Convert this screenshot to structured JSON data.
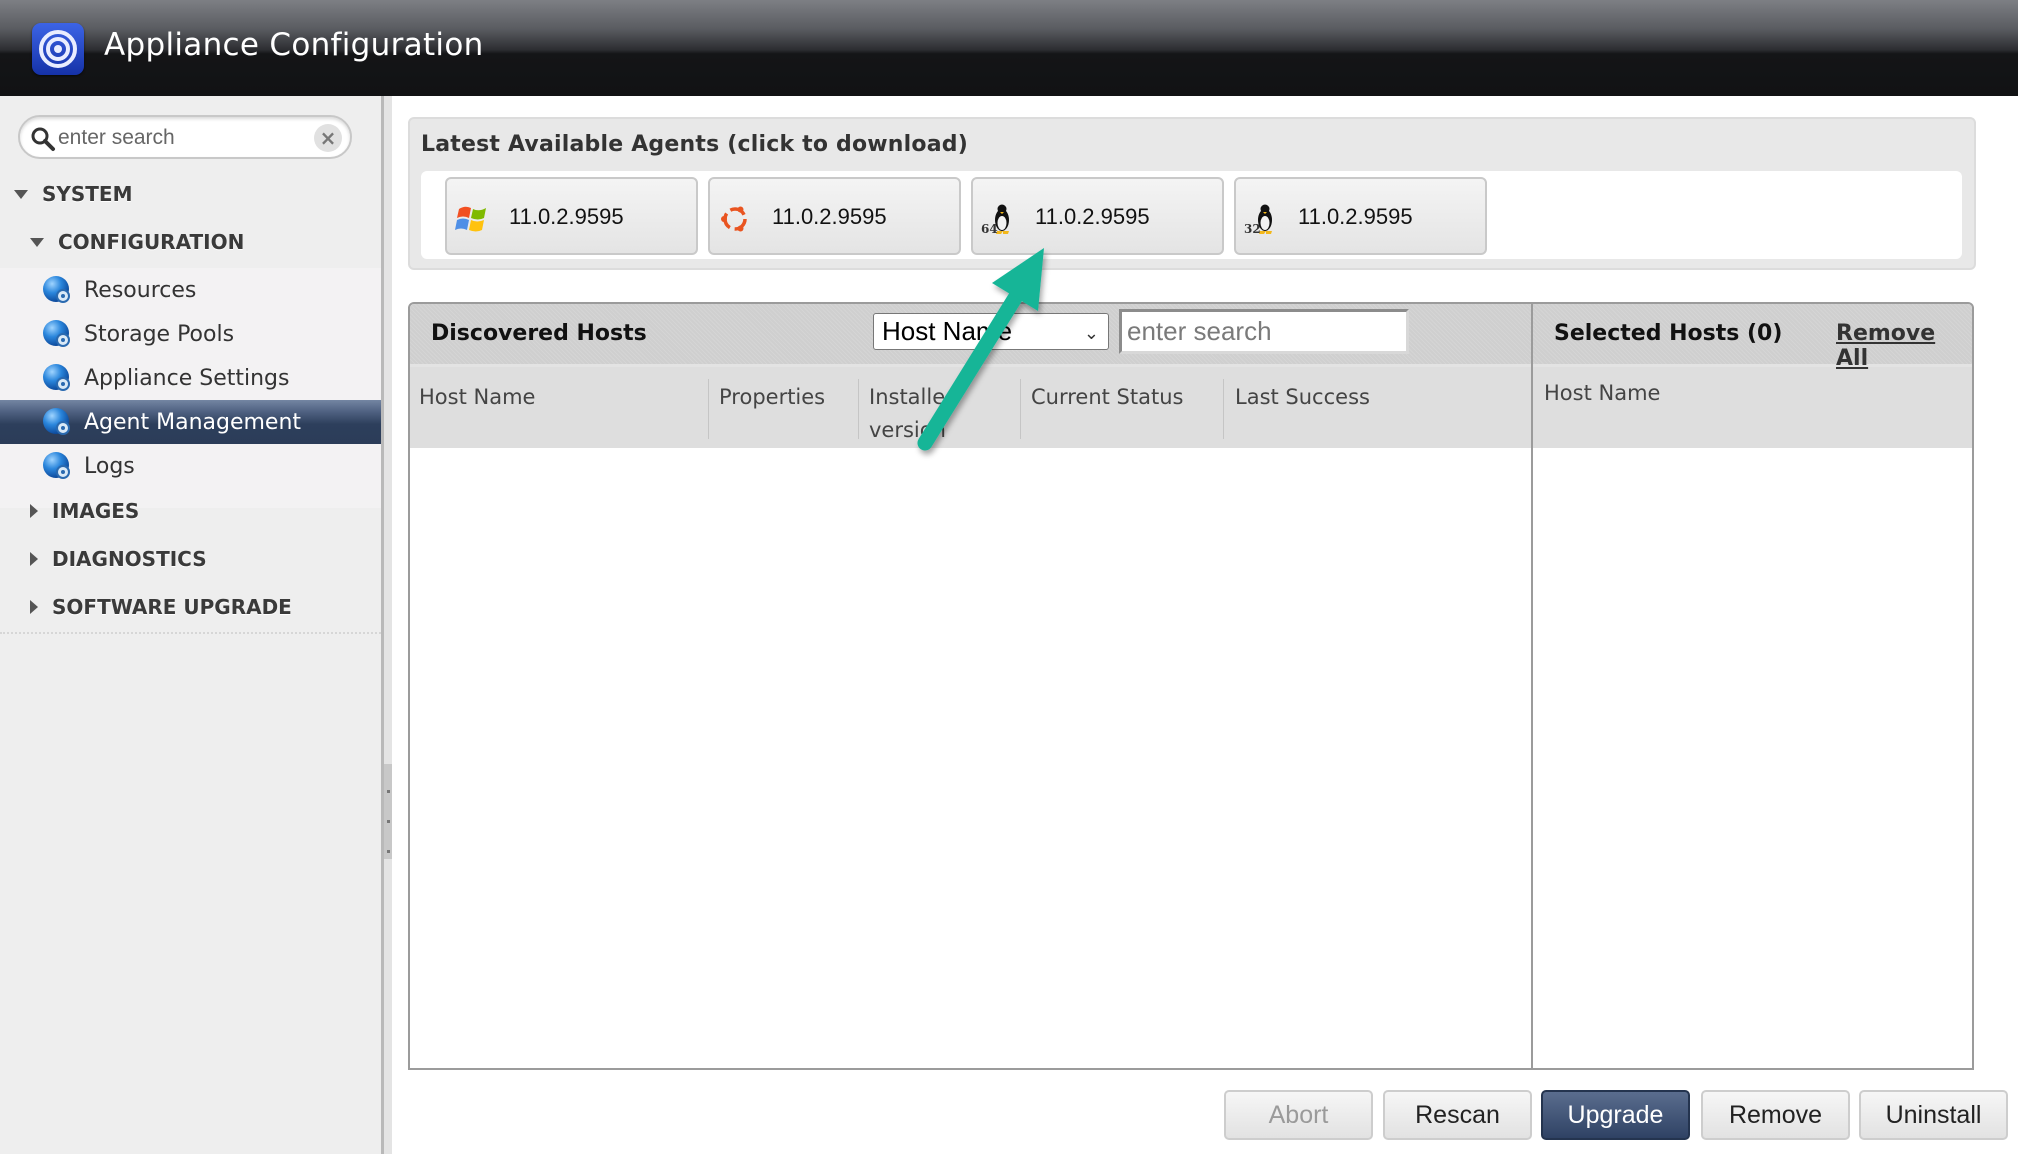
{
  "header": {
    "title": "Appliance Configuration",
    "logo_icon": "target-rings-icon"
  },
  "sidebar": {
    "search": {
      "placeholder": "enter search",
      "value": ""
    },
    "tree": {
      "system": {
        "label": "SYSTEM",
        "expanded": true
      },
      "configuration": {
        "label": "CONFIGURATION",
        "expanded": true
      },
      "items": [
        {
          "label": "Resources",
          "icon": "globe-gear-icon",
          "active": false
        },
        {
          "label": "Storage Pools",
          "icon": "globe-gear-icon",
          "active": false
        },
        {
          "label": "Appliance Settings",
          "icon": "globe-gear-icon",
          "active": false
        },
        {
          "label": "Agent Management",
          "icon": "globe-gear-icon",
          "active": true
        },
        {
          "label": "Logs",
          "icon": "globe-gear-icon",
          "active": false
        }
      ],
      "collapsed_sections": [
        {
          "label": "IMAGES"
        },
        {
          "label": "DIAGNOSTICS"
        },
        {
          "label": "SOFTWARE UPGRADE"
        }
      ]
    }
  },
  "agents": {
    "title": "Latest Available Agents (click to download)",
    "items": [
      {
        "os": "windows",
        "icon": "windows-logo-icon",
        "version": "11.0.2.9595"
      },
      {
        "os": "ubuntu",
        "icon": "ubuntu-logo-icon",
        "version": "11.0.2.9595"
      },
      {
        "os": "linux-64",
        "icon": "linux-tux-64-icon",
        "version": "11.0.2.9595"
      },
      {
        "os": "linux-32",
        "icon": "linux-tux-32-icon",
        "version": "11.0.2.9595"
      }
    ]
  },
  "discovered": {
    "title": "Discovered Hosts",
    "filter_field": {
      "selected": "Host Name"
    },
    "search": {
      "placeholder": "enter search",
      "value": ""
    },
    "columns": [
      "Host Name",
      "Properties",
      "Installed version",
      "Current Status",
      "Last Success"
    ],
    "rows": []
  },
  "selected": {
    "title": "Selected Hosts (0)",
    "count": 0,
    "remove_all_label": "Remove All",
    "columns": [
      "Host Name"
    ],
    "rows": []
  },
  "actions": {
    "abort": {
      "label": "Abort",
      "enabled": false
    },
    "rescan": {
      "label": "Rescan",
      "enabled": true
    },
    "upgrade": {
      "label": "Upgrade",
      "enabled": true,
      "primary": true
    },
    "remove": {
      "label": "Remove",
      "enabled": true
    },
    "uninstall": {
      "label": "Uninstall",
      "enabled": true
    }
  },
  "annotation": {
    "type": "arrow",
    "color": "#16b597",
    "points_to": "linux-64 agent download button"
  }
}
